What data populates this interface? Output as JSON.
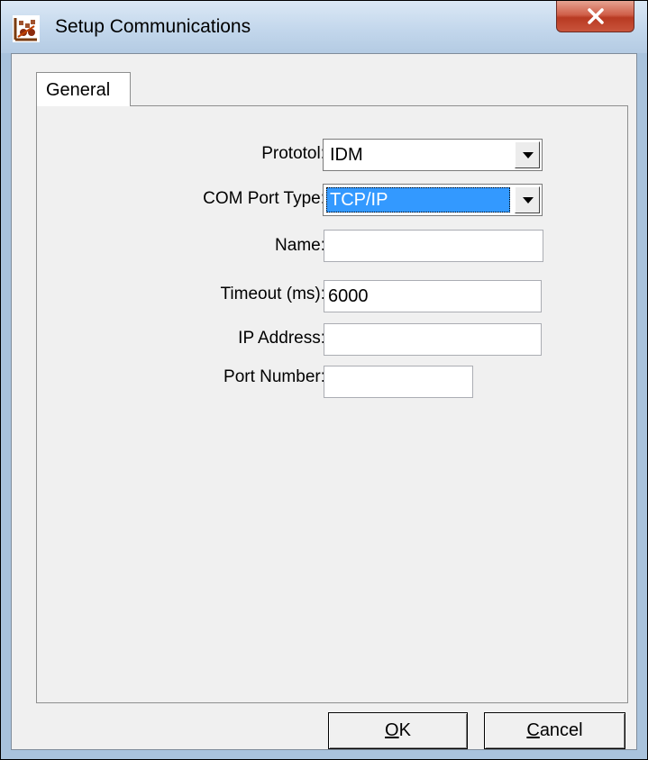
{
  "window": {
    "title": "Setup Communications",
    "icon": "setup-communications-app-icon",
    "close_icon": "close-x-icon"
  },
  "tabs": [
    {
      "label": "General",
      "selected": true
    }
  ],
  "form": {
    "protocol": {
      "label": "Prototol:",
      "value": "IDM"
    },
    "com_port_type": {
      "label": "COM Port Type:",
      "value": "TCP/IP",
      "focused": true
    },
    "name": {
      "label": "Name:",
      "value": ""
    },
    "timeout": {
      "label": "Timeout (ms):",
      "value": "6000"
    },
    "ip_address": {
      "label": "IP Address:",
      "value": ""
    },
    "port_number": {
      "label": "Port Number:",
      "value": ""
    }
  },
  "buttons": {
    "ok": {
      "mnemonic": "O",
      "rest": "K"
    },
    "cancel": {
      "mnemonic": "C",
      "rest": "ancel"
    }
  },
  "colors": {
    "selection": "#3399ff",
    "close_button": "#c9543c",
    "dialog_face": "#f0f0f0"
  }
}
